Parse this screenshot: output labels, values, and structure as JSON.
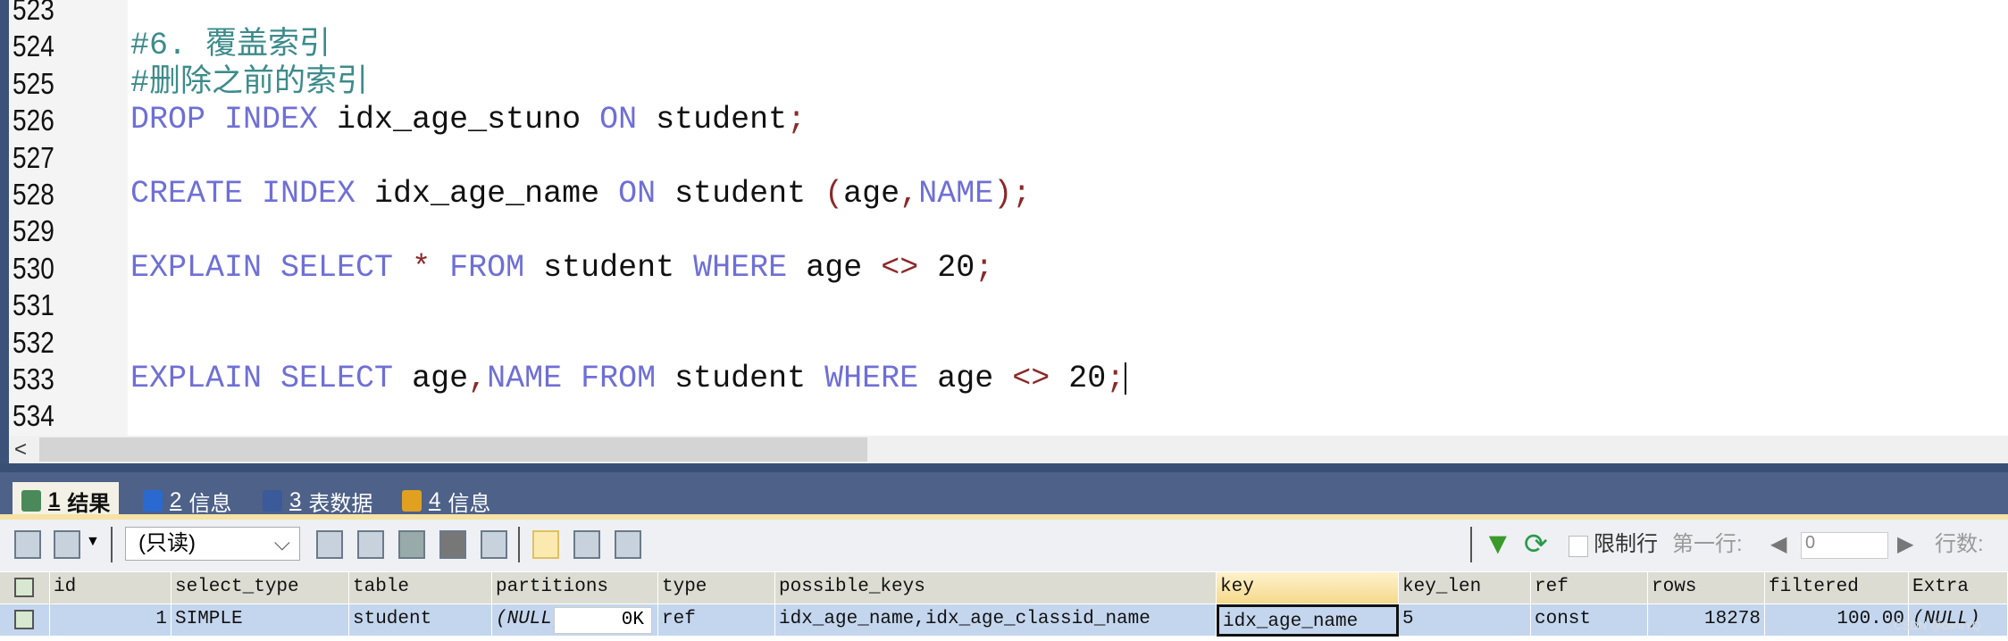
{
  "editor": {
    "lines": [
      {
        "num": "523",
        "tokens": []
      },
      {
        "num": "524",
        "tokens": [
          {
            "t": "#6. 覆盖索引",
            "c": "cm"
          }
        ]
      },
      {
        "num": "525",
        "tokens": [
          {
            "t": "#删除之前的索引",
            "c": "cm"
          }
        ]
      },
      {
        "num": "526",
        "tokens": [
          {
            "t": "DROP INDEX",
            "c": "kw"
          },
          {
            "t": " idx_age_stuno ",
            "c": "tx"
          },
          {
            "t": "ON",
            "c": "kw"
          },
          {
            "t": " student",
            "c": "tx"
          },
          {
            "t": ";",
            "c": "op"
          }
        ]
      },
      {
        "num": "527",
        "tokens": []
      },
      {
        "num": "528",
        "tokens": [
          {
            "t": "CREATE INDEX",
            "c": "kw"
          },
          {
            "t": " idx_age_name ",
            "c": "tx"
          },
          {
            "t": "ON",
            "c": "kw"
          },
          {
            "t": " student ",
            "c": "tx"
          },
          {
            "t": "(",
            "c": "op"
          },
          {
            "t": "age",
            "c": "tx"
          },
          {
            "t": ",",
            "c": "op"
          },
          {
            "t": "NAME",
            "c": "kw"
          },
          {
            "t": ");",
            "c": "op"
          }
        ]
      },
      {
        "num": "529",
        "tokens": []
      },
      {
        "num": "530",
        "tokens": [
          {
            "t": "EXPLAIN SELECT",
            "c": "kw"
          },
          {
            "t": " ",
            "c": "tx"
          },
          {
            "t": "*",
            "c": "op"
          },
          {
            "t": " ",
            "c": "tx"
          },
          {
            "t": "FROM",
            "c": "kw"
          },
          {
            "t": " student ",
            "c": "tx"
          },
          {
            "t": "WHERE",
            "c": "kw"
          },
          {
            "t": " age ",
            "c": "tx"
          },
          {
            "t": "<>",
            "c": "op"
          },
          {
            "t": " 20",
            "c": "tx"
          },
          {
            "t": ";",
            "c": "op"
          }
        ]
      },
      {
        "num": "531",
        "tokens": []
      },
      {
        "num": "532",
        "tokens": []
      },
      {
        "num": "533",
        "tokens": [
          {
            "t": "EXPLAIN SELECT",
            "c": "kw"
          },
          {
            "t": " age",
            "c": "tx"
          },
          {
            "t": ",",
            "c": "op"
          },
          {
            "t": "NAME",
            "c": "kw"
          },
          {
            "t": " ",
            "c": "tx"
          },
          {
            "t": "FROM",
            "c": "kw"
          },
          {
            "t": " student ",
            "c": "tx"
          },
          {
            "t": "WHERE",
            "c": "kw"
          },
          {
            "t": " age ",
            "c": "tx"
          },
          {
            "t": "<>",
            "c": "op"
          },
          {
            "t": " 20",
            "c": "tx"
          },
          {
            "t": ";",
            "c": "op"
          }
        ],
        "caret": true
      },
      {
        "num": "534",
        "tokens": []
      }
    ],
    "scroll_left_arrow": "<"
  },
  "tabs": [
    {
      "num": "1",
      "label": "结果",
      "icon": "result-icon",
      "active": true
    },
    {
      "num": "2",
      "label": "信息",
      "icon": "info-icon"
    },
    {
      "num": "3",
      "label": "表数据",
      "icon": "table-data-icon"
    },
    {
      "num": "4",
      "label": "信息",
      "icon": "info2-icon"
    }
  ],
  "toolbar": {
    "mode_select": "(只读)",
    "limit_rows_label": "限制行",
    "first_row_label": "第一行:",
    "first_row_value": "0",
    "row_count_label": "行数:"
  },
  "grid": {
    "columns": [
      "id",
      "select_type",
      "table",
      "partitions",
      "type",
      "possible_keys",
      "key",
      "key_len",
      "ref",
      "rows",
      "filtered",
      "Extra"
    ],
    "rows": [
      [
        "1",
        "SIMPLE",
        "student",
        "(NULL)",
        "ref",
        "idx_age_name,idx_age_classid_name",
        "idx_age_name",
        "5",
        "const",
        "18278",
        "100.00",
        "(NULL)"
      ]
    ],
    "partitions_edit_value": "0K"
  },
  "watermark": "CSDN @caraYQ",
  "colors": {
    "keyword": "#6f6fd6",
    "comment": "#3d8b8b",
    "operator": "#8b2a2a",
    "panel": "#4d6189",
    "selected_row": "#c4d6ee"
  }
}
